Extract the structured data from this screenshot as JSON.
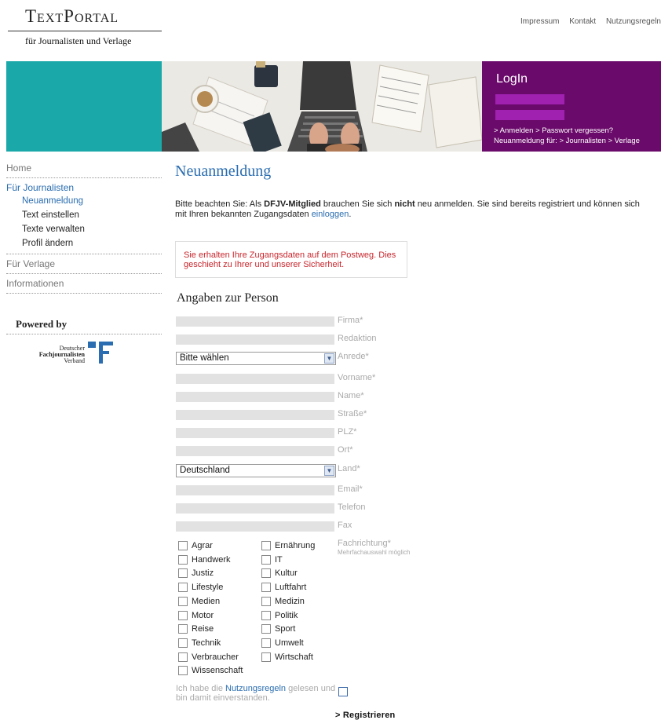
{
  "logo": {
    "title": "TextPortal",
    "subtitle": "für Journalisten und Verlage"
  },
  "toplinks": [
    "Impressum",
    "Kontakt",
    "Nutzungsregeln"
  ],
  "login": {
    "title": "LogIn",
    "line1": "> Anmelden > Passwort vergessen?",
    "line2": "Neuanmeldung für: > Journalisten > Verlage"
  },
  "nav": {
    "home": "Home",
    "journalists": "Für Journalisten",
    "sub": [
      "Neuanmeldung",
      "Text einstellen",
      "Texte verwalten",
      "Profil ändern"
    ],
    "publishers": "Für Verlage",
    "info": "Informationen"
  },
  "powered": {
    "label": "Powered by",
    "org_line1": "Deutscher",
    "org_line2": "Fachjournalisten",
    "org_line3": "Verband"
  },
  "page": {
    "title": "Neuanmeldung",
    "intro_a": "Bitte beachten Sie: Als ",
    "intro_b": "DFJV-Mitglied",
    "intro_c": " brauchen Sie sich ",
    "intro_d": "nicht",
    "intro_e": " neu anmelden. Sie sind bereits registriert und können sich mit Ihren bekannten Zugangsdaten ",
    "intro_link": "einloggen",
    "intro_end": ".",
    "notice": "Sie erhalten Ihre Zugangsdaten auf dem Postweg. Dies geschieht zu Ihrer und unserer Sicherheit.",
    "section": "Angaben zur Person"
  },
  "form": {
    "firma": "Firma*",
    "redaktion": "Redaktion",
    "anrede": "Anrede*",
    "anrede_value": "Bitte wählen",
    "vorname": "Vorname*",
    "name": "Name*",
    "strasse": "Straße*",
    "plz": "PLZ*",
    "ort": "Ort*",
    "land": "Land*",
    "land_value": "Deutschland",
    "email": "Email*",
    "telefon": "Telefon",
    "fax": "Fax",
    "fach": "Fachrichtung*",
    "fach_hint": "Mehrfachauswahl möglich",
    "col1": [
      "Agrar",
      "Handwerk",
      "Justiz",
      "Lifestyle",
      "Medien",
      "Motor",
      "Reise",
      "Technik",
      "Verbraucher",
      "Wissenschaft"
    ],
    "col2": [
      "Ernährung",
      "IT",
      "Kultur",
      "Luftfahrt",
      "Medizin",
      "Politik",
      "Sport",
      "Umwelt",
      "Wirtschaft"
    ],
    "terms_a": "Ich habe die ",
    "terms_link": "Nutzungsregeln",
    "terms_b": " gelesen und bin damit einverstanden.",
    "submit": "> Registrieren"
  },
  "colors": {
    "teal": "#1aa8a8",
    "purple": "#6a0a6a",
    "link": "#2a6db0",
    "notice": "#c8262c"
  }
}
